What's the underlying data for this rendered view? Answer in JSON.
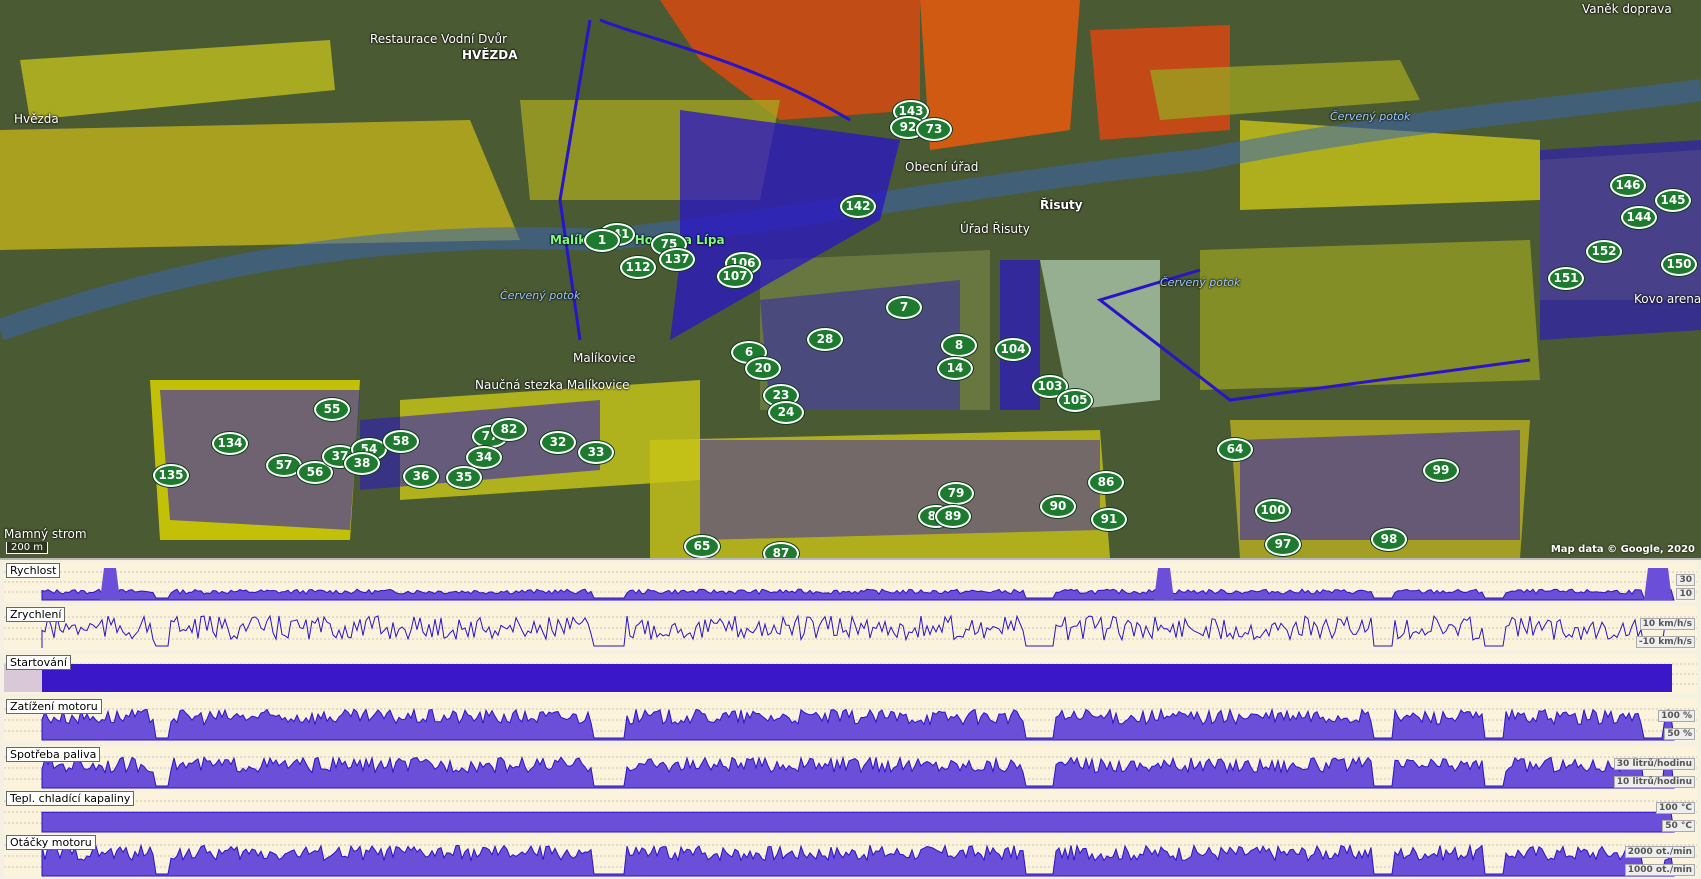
{
  "map": {
    "place_labels": [
      {
        "text": "HVĚZDA",
        "kind": "bold"
      },
      {
        "text": "Restaurace Vodní Dvůr",
        "kind": "normal"
      },
      {
        "text": "Hvězda",
        "kind": "normal"
      },
      {
        "text": "Malíkovice",
        "kind": "normal"
      },
      {
        "text": "Naučná stezka Malíkovice",
        "kind": "normal"
      },
      {
        "text": "Malíkovice - Hoskova Lípa",
        "kind": "green"
      },
      {
        "text": "Úřad Řisuty",
        "kind": "normal"
      },
      {
        "text": "Obecní úřad",
        "kind": "normal"
      },
      {
        "text": "Řisuty",
        "kind": "bold"
      },
      {
        "text": "Červený potok",
        "kind": "river"
      },
      {
        "text": "Červený potok",
        "kind": "river"
      },
      {
        "text": "Červený potok",
        "kind": "river"
      },
      {
        "text": "Mamný strom",
        "kind": "normal"
      },
      {
        "text": "Vaněk doprava",
        "kind": "normal"
      },
      {
        "text": "Kovo arena",
        "kind": "normal"
      }
    ],
    "markers": [
      "143",
      "92",
      "73",
      "142",
      "141",
      "1",
      "75",
      "137",
      "112",
      "106",
      "107",
      "7",
      "28",
      "6",
      "20",
      "8",
      "14",
      "104",
      "103",
      "105",
      "23",
      "24",
      "55",
      "134",
      "135",
      "57",
      "56",
      "37",
      "54",
      "38",
      "58",
      "77",
      "82",
      "34",
      "36",
      "35",
      "32",
      "33",
      "79",
      "88",
      "89",
      "90",
      "86",
      "91",
      "64",
      "100",
      "99",
      "97",
      "98",
      "65",
      "87",
      "146",
      "145",
      "144",
      "152",
      "150",
      "151"
    ],
    "scale_label": "200 m",
    "attribution": "Map data © Google, 2020",
    "colors": {
      "marker": "#1d7a2e",
      "track": "#2a14c8",
      "field_yellow": "#d8d400",
      "field_red": "#d64a12"
    }
  },
  "charts": [
    {
      "label": "Rychlost",
      "scale": [
        "30",
        "10"
      ],
      "kind": "spiky"
    },
    {
      "label": "Zrychlení",
      "scale": [
        "10 km/h/s",
        "-10 km/h/s"
      ],
      "kind": "oscillate"
    },
    {
      "label": "Startování",
      "scale": [],
      "kind": "solid"
    },
    {
      "label": "Zatížení motoru",
      "scale": [
        "100 %",
        "50 %"
      ],
      "kind": "area"
    },
    {
      "label": "Spotřeba paliva",
      "scale": [
        "30 litrů/hodinu",
        "10 litrů/hodinu"
      ],
      "kind": "area"
    },
    {
      "label": "Tepl. chladící kapaliny",
      "scale": [
        "100 °C",
        "50 °C"
      ],
      "kind": "flat"
    },
    {
      "label": "Otáčky motoru",
      "scale": [
        "2000 ot./min",
        "1000 ot./min"
      ],
      "kind": "area"
    }
  ]
}
